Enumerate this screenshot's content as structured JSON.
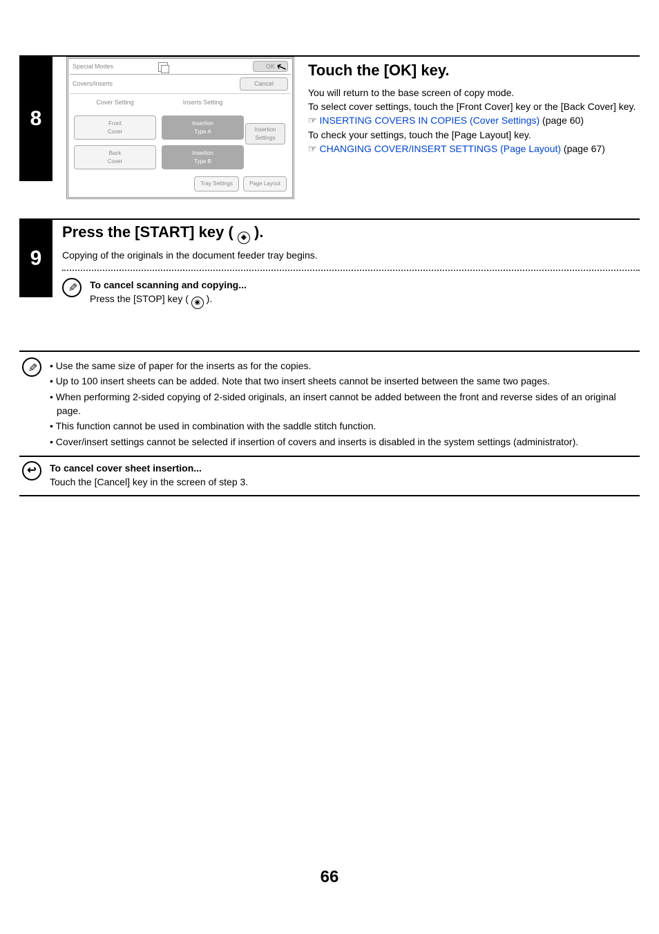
{
  "steps": {
    "s8": {
      "num": "8",
      "title": "Touch the [OK] key.",
      "p1": "You will return to the base screen of copy mode.",
      "p2": "To select cover settings, touch the [Front Cover] key or the [Back Cover] key.",
      "link1": "INSERTING COVERS IN COPIES (Cover Settings)",
      "link1_suffix": " (page 60)",
      "p3": "To check your settings, touch the [Page Layout] key.",
      "link2": "CHANGING COVER/INSERT SETTINGS (Page Layout)",
      "link2_suffix": " (page 67)"
    },
    "s9": {
      "num": "9",
      "title_a": "Press the [START] key ( ",
      "title_b": " ).",
      "p1": "Copying of the originals in the document feeder tray begins.",
      "cancel_h": "To cancel scanning and copying...",
      "cancel_p_a": "Press the [STOP] key ( ",
      "cancel_p_b": " )."
    }
  },
  "dialog": {
    "title": "Special Modes",
    "ok": "OK",
    "subtitle": "Covers/Inserts",
    "cancel": "Cancel",
    "col_a_h": "Cover Setting",
    "col_b_h": "Inserts Setting",
    "front": "Front\nCover",
    "back": "Back\nCover",
    "typeA": "Insertion\nType A",
    "typeB": "Insertion\nType B",
    "side": "Insertion\nSettings",
    "foot1": "Tray Settings",
    "foot2": "Page Layout"
  },
  "info1": {
    "li1": "Use the same size of paper for the inserts as for the copies.",
    "li2": "Up to 100 insert sheets can be added. Note that two insert sheets cannot be inserted between the same two pages.",
    "li3": "When performing 2-sided copying of 2-sided originals, an insert cannot be added between the front and reverse sides of an original page.",
    "li4": "This function cannot be used in combination with the saddle stitch function.",
    "li5": "Cover/insert settings cannot be selected if insertion of covers and inserts is disabled in the system settings (administrator)."
  },
  "info2": {
    "h": "To cancel cover sheet insertion...",
    "p": "Touch the [Cancel] key in the screen of step 3."
  },
  "page_num": "66"
}
